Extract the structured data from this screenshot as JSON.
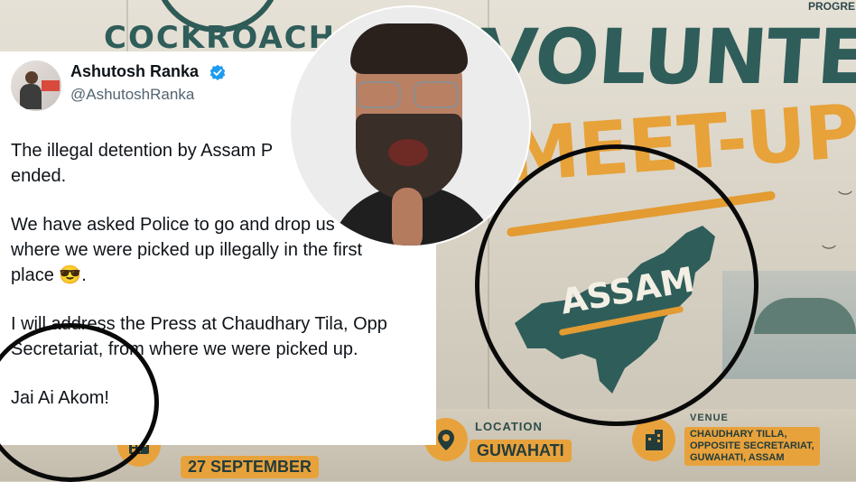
{
  "poster": {
    "brand_text": "COCKROACH",
    "progress_text": "PROGRE",
    "headline_1": "VOLUNTEER",
    "headline_2": "MEET-UP",
    "map_label": "ASSAM",
    "location_title": "LOCATION",
    "location_value": "GUWAHATI",
    "date_value": "27 SEPTEMBER",
    "venue_title": "VENUE",
    "venue_lines": "CHAUDHARY TILLA,\nOPPOSITE SECRETARIAT,\nGUWAHATI, ASSAM",
    "colors": {
      "teal": "#2f5d5a",
      "orange": "#e8a23c"
    }
  },
  "tweet": {
    "author_name": "Ashutosh Ranka",
    "author_handle": "@AshutoshRanka",
    "verified": true,
    "paragraphs": [
      "The illegal detention by Assam P\nended.",
      "We have asked Police to go and drop us\nwhere we were picked up illegally in the first\nplace 😎.",
      "I will address the Press at Chaudhary Tila, Opp\nSecretariat, from where we were picked up.",
      "Jai Ai Akom!"
    ]
  },
  "icons": {
    "verified": "verified-badge-icon",
    "location": "location-pin-icon",
    "calendar": "calendar-icon",
    "venue": "building-icon"
  }
}
